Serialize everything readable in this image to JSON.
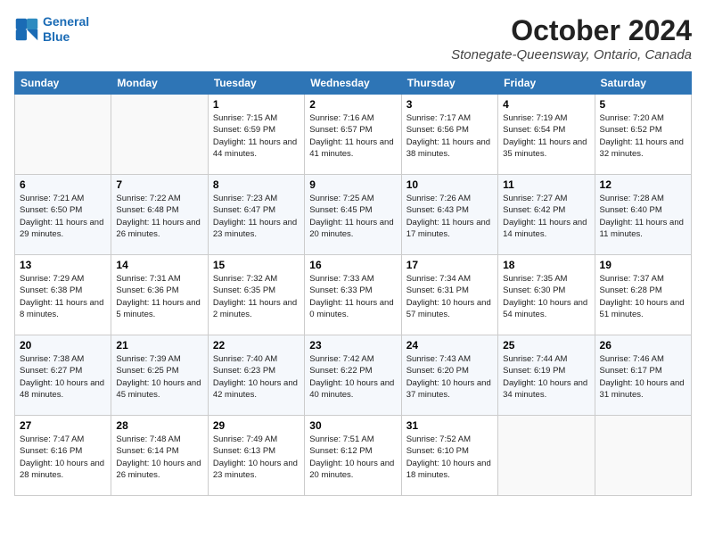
{
  "logo": {
    "line1": "General",
    "line2": "Blue"
  },
  "title": "October 2024",
  "location": "Stonegate-Queensway, Ontario, Canada",
  "weekdays": [
    "Sunday",
    "Monday",
    "Tuesday",
    "Wednesday",
    "Thursday",
    "Friday",
    "Saturday"
  ],
  "weeks": [
    [
      {
        "day": "",
        "info": ""
      },
      {
        "day": "",
        "info": ""
      },
      {
        "day": "1",
        "info": "Sunrise: 7:15 AM\nSunset: 6:59 PM\nDaylight: 11 hours and 44 minutes."
      },
      {
        "day": "2",
        "info": "Sunrise: 7:16 AM\nSunset: 6:57 PM\nDaylight: 11 hours and 41 minutes."
      },
      {
        "day": "3",
        "info": "Sunrise: 7:17 AM\nSunset: 6:56 PM\nDaylight: 11 hours and 38 minutes."
      },
      {
        "day": "4",
        "info": "Sunrise: 7:19 AM\nSunset: 6:54 PM\nDaylight: 11 hours and 35 minutes."
      },
      {
        "day": "5",
        "info": "Sunrise: 7:20 AM\nSunset: 6:52 PM\nDaylight: 11 hours and 32 minutes."
      }
    ],
    [
      {
        "day": "6",
        "info": "Sunrise: 7:21 AM\nSunset: 6:50 PM\nDaylight: 11 hours and 29 minutes."
      },
      {
        "day": "7",
        "info": "Sunrise: 7:22 AM\nSunset: 6:48 PM\nDaylight: 11 hours and 26 minutes."
      },
      {
        "day": "8",
        "info": "Sunrise: 7:23 AM\nSunset: 6:47 PM\nDaylight: 11 hours and 23 minutes."
      },
      {
        "day": "9",
        "info": "Sunrise: 7:25 AM\nSunset: 6:45 PM\nDaylight: 11 hours and 20 minutes."
      },
      {
        "day": "10",
        "info": "Sunrise: 7:26 AM\nSunset: 6:43 PM\nDaylight: 11 hours and 17 minutes."
      },
      {
        "day": "11",
        "info": "Sunrise: 7:27 AM\nSunset: 6:42 PM\nDaylight: 11 hours and 14 minutes."
      },
      {
        "day": "12",
        "info": "Sunrise: 7:28 AM\nSunset: 6:40 PM\nDaylight: 11 hours and 11 minutes."
      }
    ],
    [
      {
        "day": "13",
        "info": "Sunrise: 7:29 AM\nSunset: 6:38 PM\nDaylight: 11 hours and 8 minutes."
      },
      {
        "day": "14",
        "info": "Sunrise: 7:31 AM\nSunset: 6:36 PM\nDaylight: 11 hours and 5 minutes."
      },
      {
        "day": "15",
        "info": "Sunrise: 7:32 AM\nSunset: 6:35 PM\nDaylight: 11 hours and 2 minutes."
      },
      {
        "day": "16",
        "info": "Sunrise: 7:33 AM\nSunset: 6:33 PM\nDaylight: 11 hours and 0 minutes."
      },
      {
        "day": "17",
        "info": "Sunrise: 7:34 AM\nSunset: 6:31 PM\nDaylight: 10 hours and 57 minutes."
      },
      {
        "day": "18",
        "info": "Sunrise: 7:35 AM\nSunset: 6:30 PM\nDaylight: 10 hours and 54 minutes."
      },
      {
        "day": "19",
        "info": "Sunrise: 7:37 AM\nSunset: 6:28 PM\nDaylight: 10 hours and 51 minutes."
      }
    ],
    [
      {
        "day": "20",
        "info": "Sunrise: 7:38 AM\nSunset: 6:27 PM\nDaylight: 10 hours and 48 minutes."
      },
      {
        "day": "21",
        "info": "Sunrise: 7:39 AM\nSunset: 6:25 PM\nDaylight: 10 hours and 45 minutes."
      },
      {
        "day": "22",
        "info": "Sunrise: 7:40 AM\nSunset: 6:23 PM\nDaylight: 10 hours and 42 minutes."
      },
      {
        "day": "23",
        "info": "Sunrise: 7:42 AM\nSunset: 6:22 PM\nDaylight: 10 hours and 40 minutes."
      },
      {
        "day": "24",
        "info": "Sunrise: 7:43 AM\nSunset: 6:20 PM\nDaylight: 10 hours and 37 minutes."
      },
      {
        "day": "25",
        "info": "Sunrise: 7:44 AM\nSunset: 6:19 PM\nDaylight: 10 hours and 34 minutes."
      },
      {
        "day": "26",
        "info": "Sunrise: 7:46 AM\nSunset: 6:17 PM\nDaylight: 10 hours and 31 minutes."
      }
    ],
    [
      {
        "day": "27",
        "info": "Sunrise: 7:47 AM\nSunset: 6:16 PM\nDaylight: 10 hours and 28 minutes."
      },
      {
        "day": "28",
        "info": "Sunrise: 7:48 AM\nSunset: 6:14 PM\nDaylight: 10 hours and 26 minutes."
      },
      {
        "day": "29",
        "info": "Sunrise: 7:49 AM\nSunset: 6:13 PM\nDaylight: 10 hours and 23 minutes."
      },
      {
        "day": "30",
        "info": "Sunrise: 7:51 AM\nSunset: 6:12 PM\nDaylight: 10 hours and 20 minutes."
      },
      {
        "day": "31",
        "info": "Sunrise: 7:52 AM\nSunset: 6:10 PM\nDaylight: 10 hours and 18 minutes."
      },
      {
        "day": "",
        "info": ""
      },
      {
        "day": "",
        "info": ""
      }
    ]
  ]
}
